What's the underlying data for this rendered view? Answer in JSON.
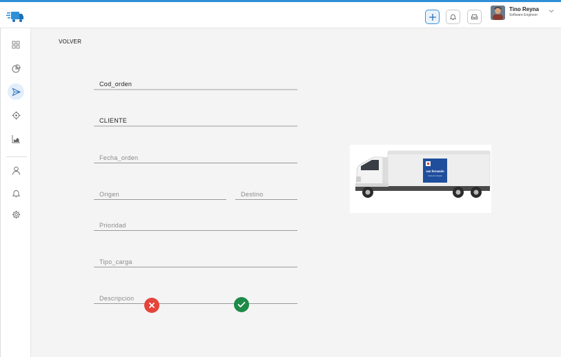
{
  "header": {
    "logo_icon": "truck-logo-icon",
    "add_icon": "plus-icon",
    "notifications_icon": "bell-icon",
    "inbox_icon": "inbox-icon",
    "user": {
      "name": "Tino Reyna",
      "role": "Software Engineer"
    },
    "menu_icon": "chevron-down-icon"
  },
  "sidebar": {
    "items": [
      {
        "icon": "grid-icon"
      },
      {
        "icon": "pie-chart-icon"
      },
      {
        "icon": "send-icon",
        "active": true
      },
      {
        "icon": "target-icon"
      },
      {
        "icon": "bar-chart-icon"
      },
      {
        "icon": "user-icon"
      },
      {
        "icon": "bell-icon"
      },
      {
        "icon": "gear-icon"
      }
    ]
  },
  "main": {
    "back_label": "VOLVER",
    "fields": {
      "cod_orden": "Cod_orden",
      "cliente": "CLIENTE",
      "fecha_orden": "Fecha_orden",
      "origen": "Origen",
      "destino": "Destino",
      "prioridad": "Prioridad",
      "tipo_carga": "Tipo_carga",
      "descripcion": "Descripcion"
    },
    "cancel_icon": "x-icon",
    "confirm_icon": "check-icon",
    "truck": {
      "brand": "san fernando",
      "tagline": "Cerca de ti siempre",
      "colors": {
        "accent": "#1f4e9c",
        "cab": "#f2f2f2"
      }
    }
  },
  "colors": {
    "accent": "#2f8fd8",
    "cancel": "#e5443b",
    "confirm": "#1e8a47"
  }
}
